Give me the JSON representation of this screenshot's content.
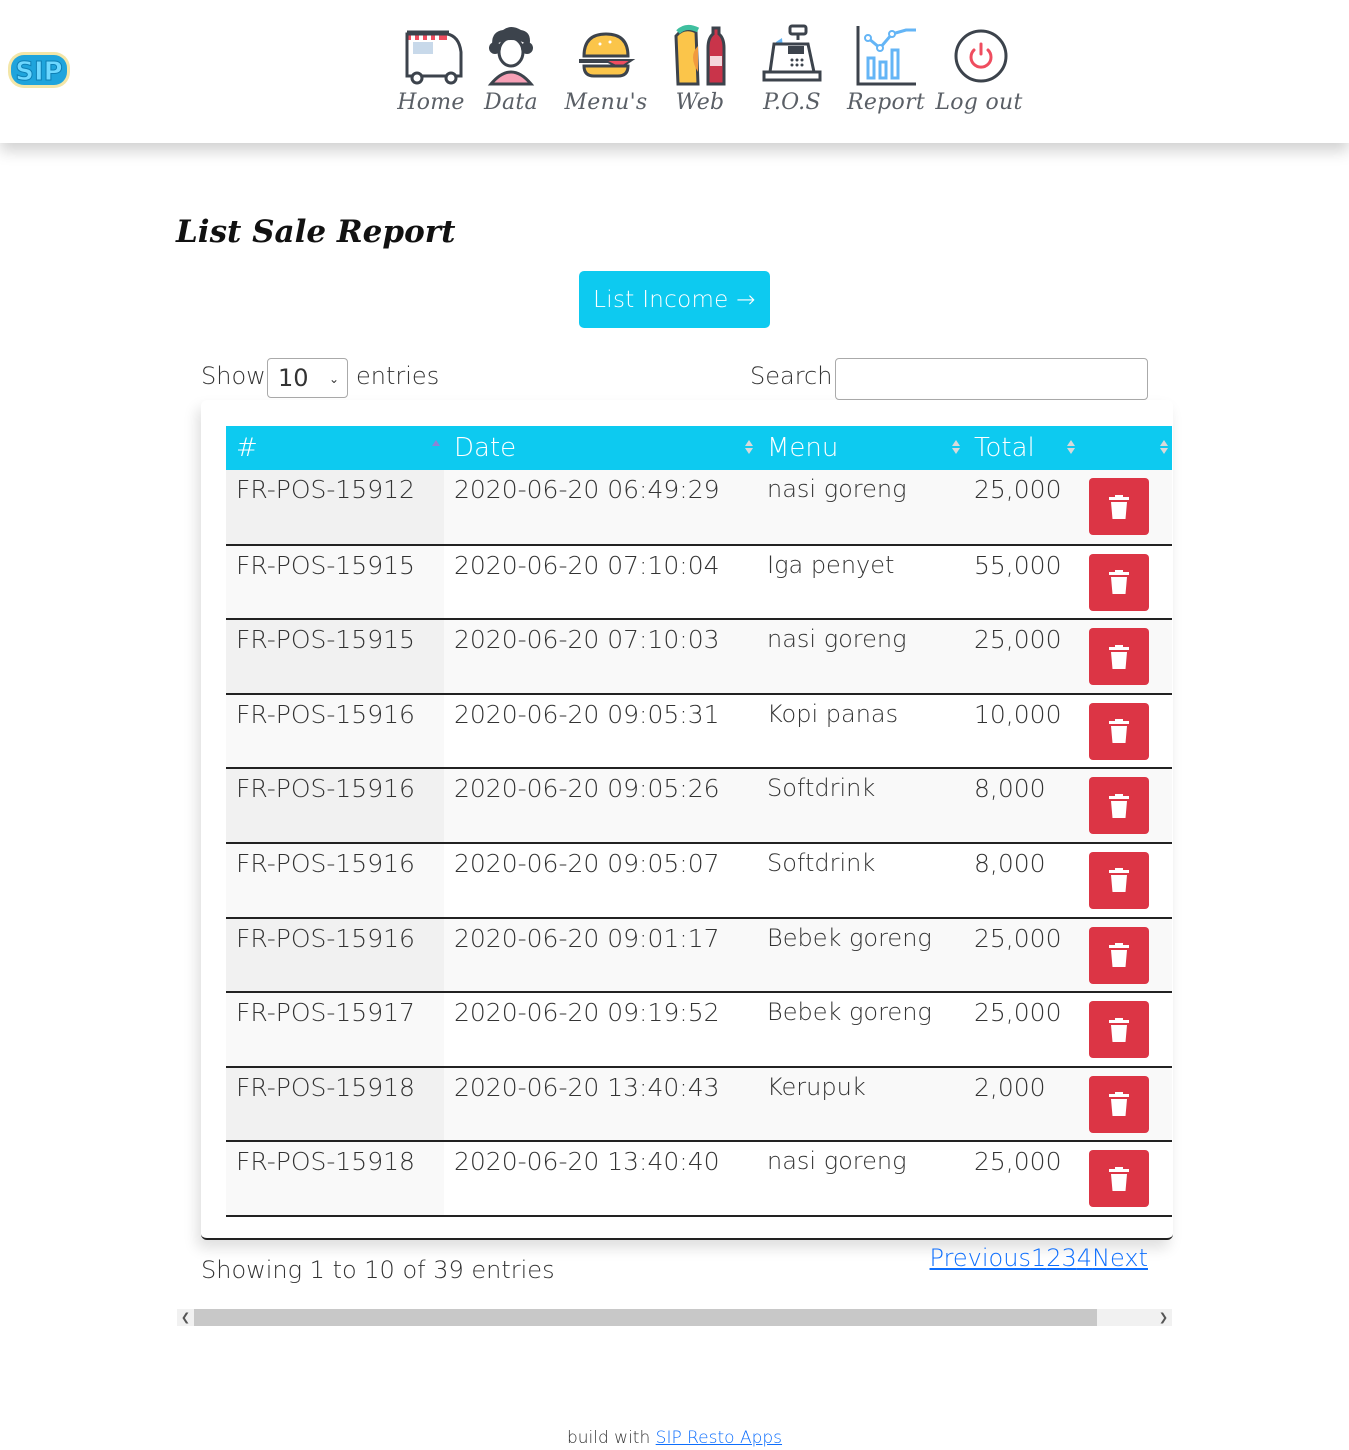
{
  "app": {
    "logo_text": "SIP"
  },
  "nav": [
    {
      "key": "home",
      "label": "Home",
      "icon": "food-truck-icon"
    },
    {
      "key": "data",
      "label": "Data",
      "icon": "person-icon"
    },
    {
      "key": "menus",
      "label": "Menu's",
      "icon": "burger-icon"
    },
    {
      "key": "web",
      "label": "Web",
      "icon": "burrito-drink-icon"
    },
    {
      "key": "pos",
      "label": "P.O.S",
      "icon": "cash-register-icon"
    },
    {
      "key": "report",
      "label": "Report",
      "icon": "bar-chart-icon"
    },
    {
      "key": "logout",
      "label": "Log out",
      "icon": "power-icon"
    }
  ],
  "page": {
    "title": "List Sale Report",
    "income_button": "List Income →"
  },
  "table_controls": {
    "show_label": "Show",
    "entries_label": "entries",
    "page_length": "10",
    "search_label": "Search:",
    "search_value": ""
  },
  "table": {
    "columns": [
      "#",
      "Date",
      "Menu",
      "Total",
      ""
    ],
    "sorted_column": 0,
    "rows": [
      {
        "id": "FR-POS-15912",
        "date": "2020-06-20 06:49:29",
        "menu": "nasi goreng",
        "total": "25,000"
      },
      {
        "id": "FR-POS-15915",
        "date": "2020-06-20 07:10:04",
        "menu": "Iga penyet",
        "total": "55,000"
      },
      {
        "id": "FR-POS-15915",
        "date": "2020-06-20 07:10:03",
        "menu": "nasi goreng",
        "total": "25,000"
      },
      {
        "id": "FR-POS-15916",
        "date": "2020-06-20 09:05:31",
        "menu": "Kopi panas",
        "total": "10,000"
      },
      {
        "id": "FR-POS-15916",
        "date": "2020-06-20 09:05:26",
        "menu": "Softdrink",
        "total": "8,000"
      },
      {
        "id": "FR-POS-15916",
        "date": "2020-06-20 09:05:07",
        "menu": "Softdrink",
        "total": "8,000"
      },
      {
        "id": "FR-POS-15916",
        "date": "2020-06-20 09:01:17",
        "menu": "Bebek goreng",
        "total": "25,000"
      },
      {
        "id": "FR-POS-15917",
        "date": "2020-06-20 09:19:52",
        "menu": "Bebek goreng",
        "total": "25,000"
      },
      {
        "id": "FR-POS-15918",
        "date": "2020-06-20 13:40:43",
        "menu": "Kerupuk",
        "total": "2,000"
      },
      {
        "id": "FR-POS-15918",
        "date": "2020-06-20 13:40:40",
        "menu": "nasi goreng",
        "total": "25,000"
      }
    ]
  },
  "pagination": {
    "info": "Showing 1 to 10 of 39 entries",
    "previous": "Previous",
    "pages": [
      "1",
      "2",
      "3",
      "4"
    ],
    "next": "Next"
  },
  "scroll": {
    "horizontal_position": 0,
    "visible_fraction": 0.94
  },
  "footer": {
    "prefix": "build with ",
    "link_text": "SIP Resto Apps"
  },
  "colors": {
    "primary": "#0dcaf0",
    "danger": "#dc3545",
    "link": "#0d6efd"
  }
}
